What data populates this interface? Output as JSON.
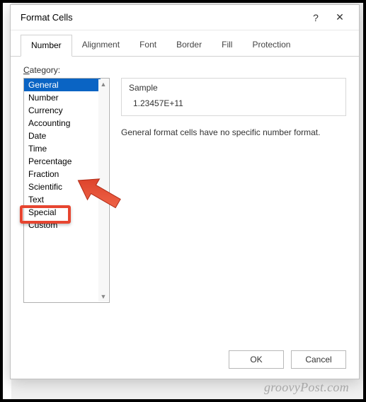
{
  "dialog": {
    "title": "Format Cells",
    "help_glyph": "?",
    "close_glyph": "✕"
  },
  "tabs": [
    {
      "label": "Number",
      "active": true
    },
    {
      "label": "Alignment",
      "active": false
    },
    {
      "label": "Font",
      "active": false
    },
    {
      "label": "Border",
      "active": false
    },
    {
      "label": "Fill",
      "active": false
    },
    {
      "label": "Protection",
      "active": false
    }
  ],
  "category": {
    "label_prefix": "C",
    "label_rest": "ategory:",
    "items": [
      {
        "label": "General",
        "selected": true
      },
      {
        "label": "Number"
      },
      {
        "label": "Currency"
      },
      {
        "label": "Accounting"
      },
      {
        "label": "Date"
      },
      {
        "label": "Time"
      },
      {
        "label": "Percentage"
      },
      {
        "label": "Fraction"
      },
      {
        "label": "Scientific"
      },
      {
        "label": "Text"
      },
      {
        "label": "Special"
      },
      {
        "label": "Custom"
      }
    ]
  },
  "sample": {
    "label": "Sample",
    "value": "1.23457E+11"
  },
  "description": "General format cells have no specific number format.",
  "buttons": {
    "ok": "OK",
    "cancel": "Cancel"
  },
  "annotation": {
    "highlighted_item": "Custom",
    "arrow_color": "#e74530"
  },
  "watermark": "groovyPost.com"
}
